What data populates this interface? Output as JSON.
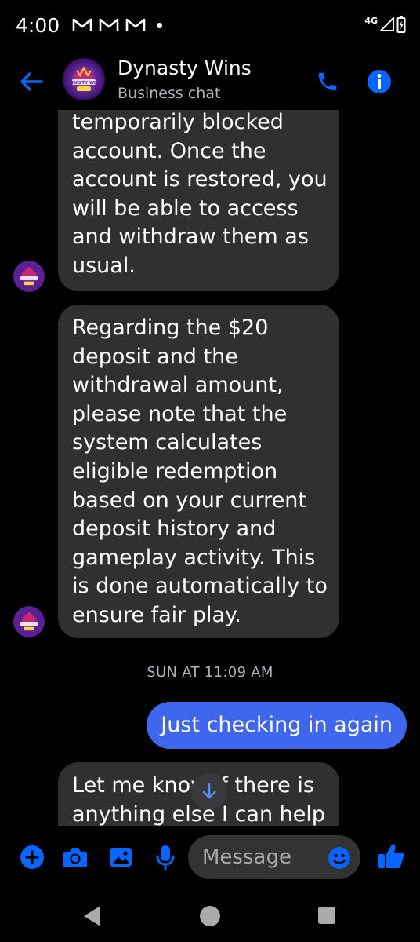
{
  "status_bar": {
    "time": "4:00",
    "network": "4G",
    "notification_icons": [
      "gmail-icon",
      "gmail-icon",
      "gmail-icon"
    ]
  },
  "header": {
    "contact_name": "Dynasty Wins",
    "subtitle": "Business chat",
    "avatar_text": "DYNASTY WINS"
  },
  "messages": [
    {
      "direction": "incoming",
      "text": "temporarily blocked account. Once the account is restored, you will be able to access and withdraw them as usual."
    },
    {
      "direction": "incoming",
      "text": "Regarding the $20 deposit and the withdrawal amount, please note that the system calculates eligible redemption based on your current deposit history and gameplay activity. This is done automatically to ensure fair play."
    },
    {
      "direction": "timestamp",
      "text": "SUN AT 11:09 AM"
    },
    {
      "direction": "outgoing",
      "text": "Just checking in again"
    },
    {
      "direction": "incoming",
      "text": "Let me know if there is anything else I can help"
    }
  ],
  "composer": {
    "placeholder": "Message"
  },
  "colors": {
    "accent": "#0866ff",
    "outgoing_bubble": "#3e67ee",
    "incoming_bubble": "#303030",
    "background": "#000000"
  }
}
